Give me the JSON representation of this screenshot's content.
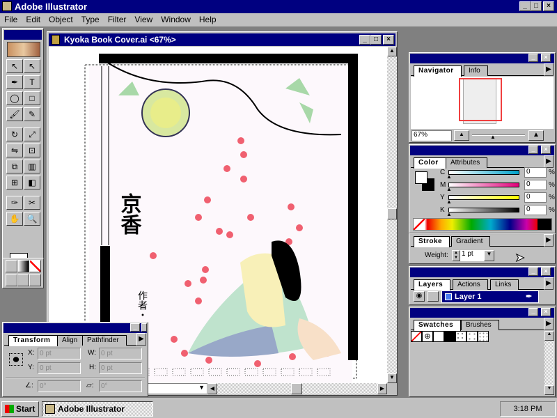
{
  "app": {
    "title": "Adobe Illustrator",
    "controls": [
      "_",
      "□",
      "×"
    ]
  },
  "menu": [
    "File",
    "Edit",
    "Object",
    "Type",
    "Filter",
    "View",
    "Window",
    "Help"
  ],
  "document": {
    "title": "Kyoka Book Cover.ai <67%>",
    "status_selector": "on",
    "artwork": {
      "title_kanji": "京香",
      "author_kanji": "作者・"
    }
  },
  "toolbox": {
    "tools": [
      "selection",
      "direct-selection",
      "pen",
      "type",
      "ellipse",
      "rectangle",
      "paintbrush",
      "pencil",
      "rotate",
      "scale",
      "reflect",
      "free-transform",
      "blend",
      "graph",
      "gradient-mesh",
      "gradient",
      "eyedropper",
      "scissors",
      "hand",
      "zoom"
    ]
  },
  "navigator": {
    "tabs": [
      "Navigator",
      "Info"
    ],
    "zoom": "67%"
  },
  "color": {
    "tabs": [
      "Color",
      "Attributes"
    ],
    "channels": [
      {
        "label": "C",
        "value": "0",
        "unit": "%",
        "color": "#00a0c8"
      },
      {
        "label": "M",
        "value": "0",
        "unit": "%",
        "color": "#e0007a"
      },
      {
        "label": "Y",
        "value": "0",
        "unit": "%",
        "color": "#ffff00"
      },
      {
        "label": "K",
        "value": "0",
        "unit": "%",
        "color": "#000000"
      }
    ]
  },
  "stroke": {
    "tabs": [
      "Stroke",
      "Gradient"
    ],
    "weight_label": "Weight:",
    "weight": "1 pt"
  },
  "layers": {
    "tabs": [
      "Layers",
      "Actions",
      "Links"
    ],
    "layer": "Layer 1",
    "layer_color": "#4a7af0"
  },
  "swatches": {
    "tabs": [
      "Swatches",
      "Brushes"
    ]
  },
  "transform": {
    "tabs": [
      "Transform",
      "Align",
      "Pathfinder"
    ],
    "x_label": "X:",
    "x": "0 pt",
    "y_label": "Y:",
    "y": "0 pt",
    "w_label": "W:",
    "w": "0 pt",
    "h_label": "H:",
    "h": "0 pt",
    "angle": "0°",
    "shear": "0°"
  },
  "taskbar": {
    "start": "Start",
    "task": "Adobe Illustrator",
    "clock": "3:18 PM"
  }
}
